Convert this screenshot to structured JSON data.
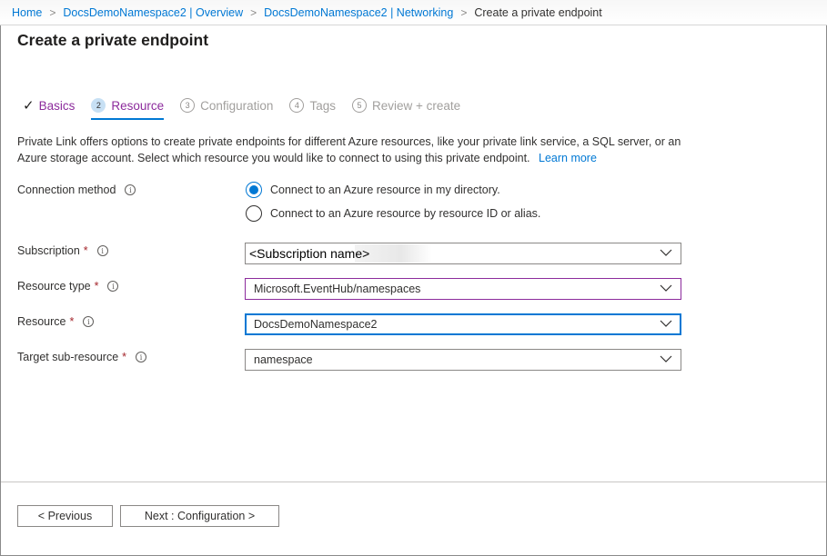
{
  "breadcrumb": {
    "items": [
      "Home",
      "DocsDemoNamespace2 | Overview",
      "DocsDemoNamespace2 | Networking"
    ],
    "current": "Create a private endpoint",
    "separator": ">"
  },
  "page_title": "Create a private endpoint",
  "tabs": [
    {
      "label": "Basics",
      "state": "done",
      "icon": "checkmark-icon"
    },
    {
      "label": "Resource",
      "number": "2",
      "state": "active"
    },
    {
      "label": "Configuration",
      "number": "3",
      "state": "pending"
    },
    {
      "label": "Tags",
      "number": "4",
      "state": "pending"
    },
    {
      "label": "Review + create",
      "number": "5",
      "state": "pending"
    }
  ],
  "description": {
    "text": "Private Link offers options to create private endpoints for different Azure resources, like your private link service, a SQL server, or an Azure storage account. Select which resource you would like to connect to using this private endpoint.",
    "link": "Learn more"
  },
  "form": {
    "connection_method": {
      "label": "Connection method",
      "info_icon": "info-icon",
      "options": [
        {
          "label": "Connect to an Azure resource in my directory.",
          "checked": true
        },
        {
          "label": "Connect to an Azure resource by resource ID or alias.",
          "checked": false
        }
      ]
    },
    "subscription": {
      "label": "Subscription",
      "required": "*",
      "value": "<Subscription name>"
    },
    "resource_type": {
      "label": "Resource type",
      "required": "*",
      "value": "Microsoft.EventHub/namespaces"
    },
    "resource": {
      "label": "Resource",
      "required": "*",
      "value": "DocsDemoNamespace2"
    },
    "target_sub_resource": {
      "label": "Target sub-resource",
      "required": "*",
      "value": "namespace"
    }
  },
  "footer": {
    "previous_label": "< Previous",
    "next_label": "Next : Configuration >"
  },
  "colors": {
    "link": "#0078d4",
    "tab_active": "#8c2b9c",
    "required": "#a4262c",
    "focus_border": "#0078d4",
    "validated_border": "#8c2b9c"
  }
}
